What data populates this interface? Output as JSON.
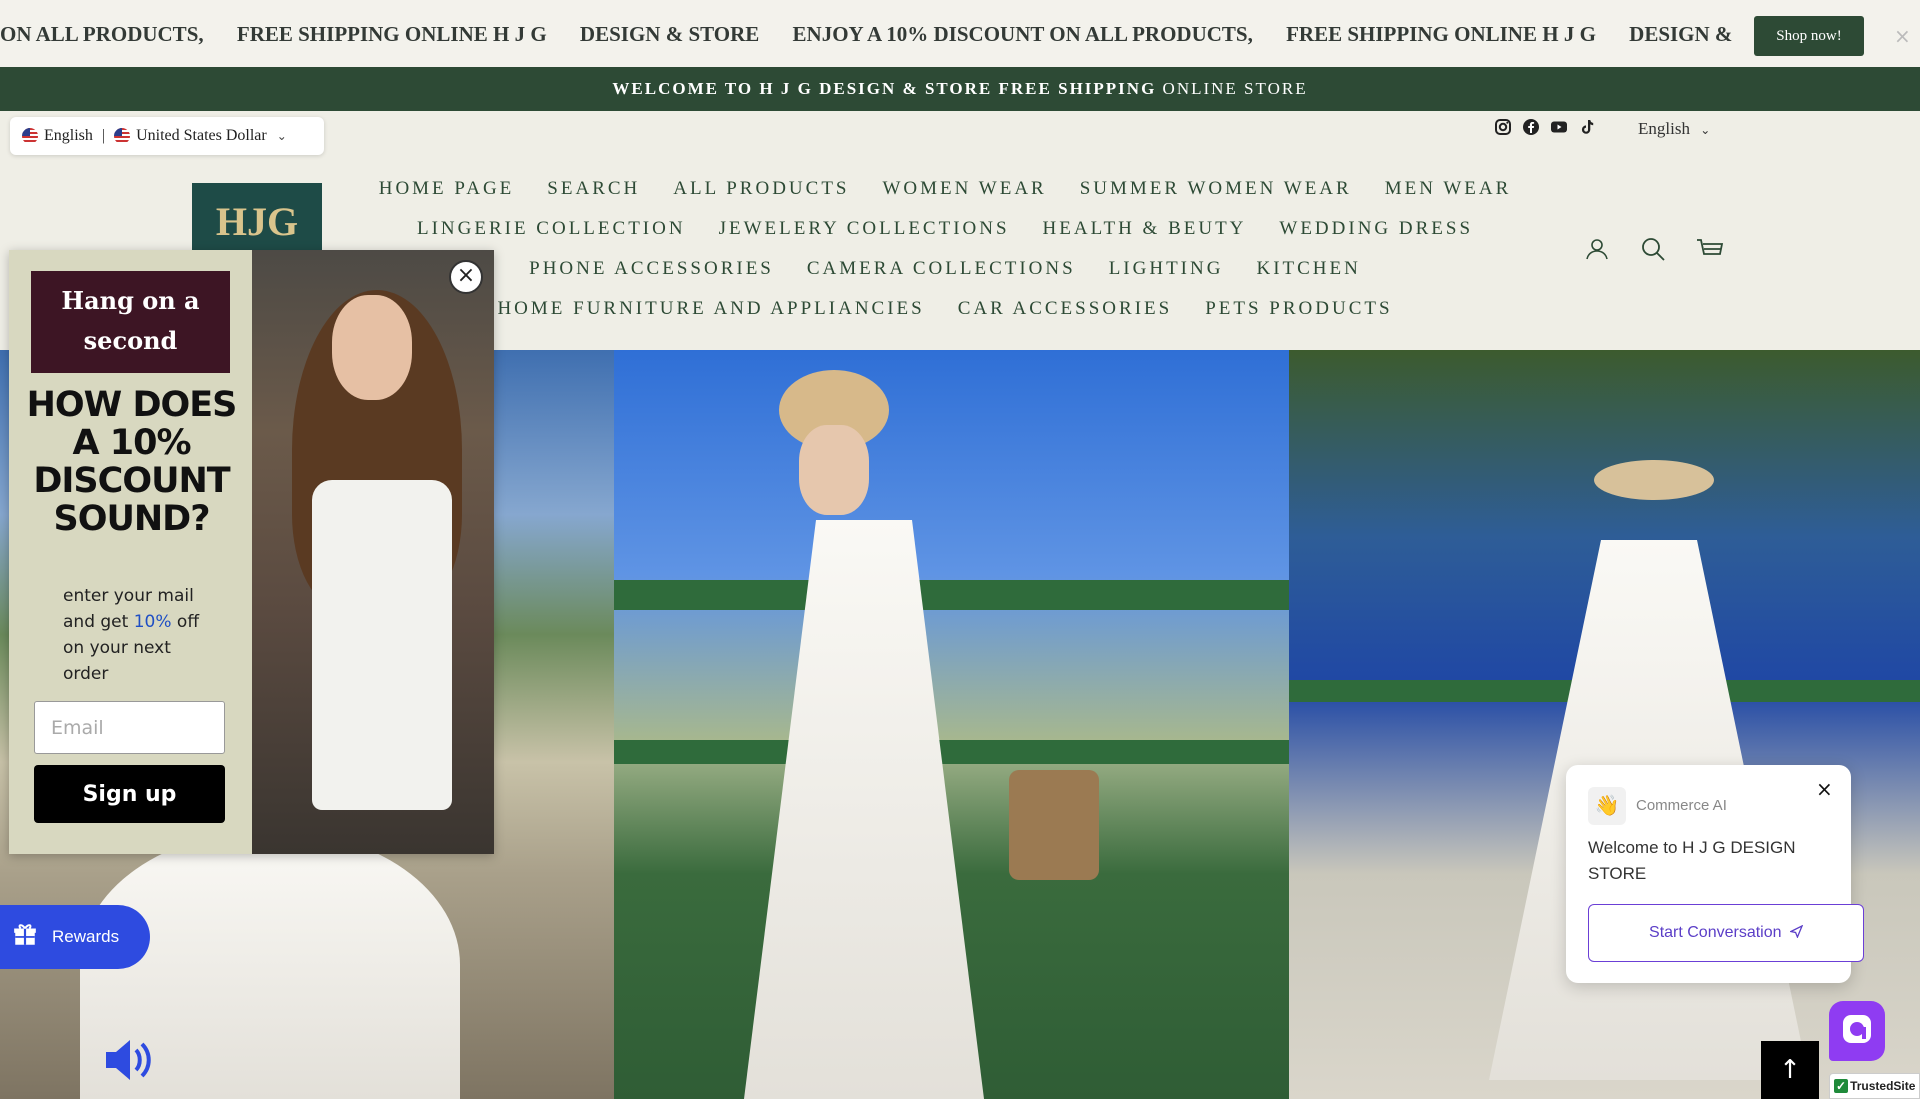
{
  "announcement": {
    "segments": [
      "ON ALL PRODUCTS,",
      "FREE SHIPPING ONLINE  H J G",
      "DESIGN  &  STORE",
      "ENJOY A 10% DISCOUNT ON ALL PRODUCTS,",
      "FREE SHIPPING ONLINE  H J G",
      "DESIGN  &"
    ],
    "cta": "Shop now!",
    "close": "×"
  },
  "welcome": {
    "bold": "WELCOME TO H J G DESIGN & STORE FREE SHIPPING",
    "rest": "ONLINE STORE"
  },
  "locale": {
    "language": "English",
    "separator": "|",
    "currency": "United States Dollar"
  },
  "header": {
    "language": "English",
    "logo_text": "HJG",
    "social_icons": [
      "instagram-icon",
      "facebook-icon",
      "youtube-icon",
      "tiktok-icon"
    ],
    "nav_rows": [
      [
        "HOME PAGE",
        "SEARCH",
        "ALL PRODUCTS",
        "WOMEN WEAR",
        "SUMMER WOMEN WEAR",
        "MEN WEAR"
      ],
      [
        "LINGERIE COLLECTION",
        "JEWELERY COLLECTIONS",
        "HEALTH & BEUTY",
        "WEDDING DRESS"
      ],
      [
        "PHONE ACCESSORIES",
        "CAMERA COLLECTIONS",
        "LIGHTING",
        "KITCHEN"
      ],
      [
        "HOME FURNITURE AND APPLIANCIES",
        "CAR ACCESSORIES",
        "PETS PRODUCTS"
      ]
    ],
    "icons": [
      "account-icon",
      "search-icon",
      "cart-icon"
    ]
  },
  "popup": {
    "tagline": "Hang on a second",
    "headline": "HOW DOES A 10% DISCOUNT SOUND?",
    "sub_before": "enter your mail and get ",
    "sub_accent": "10%",
    "sub_after": " off on your next order",
    "email_placeholder": "Email",
    "signup": "Sign up",
    "close": "×"
  },
  "rewards": {
    "label": "Rewards"
  },
  "chat": {
    "brand": "Commerce AI",
    "avatar": "👋",
    "message": "Welcome to H J G DESIGN STORE",
    "button": "Start Conversation",
    "close": "×"
  },
  "back_to_top": "↑",
  "trusted": {
    "mark": "✓",
    "label": "TrustedSite"
  },
  "colors": {
    "brand_green": "#2d4a35",
    "accent_blue": "#2e4be0",
    "chat_purple": "#8f3cf2"
  }
}
